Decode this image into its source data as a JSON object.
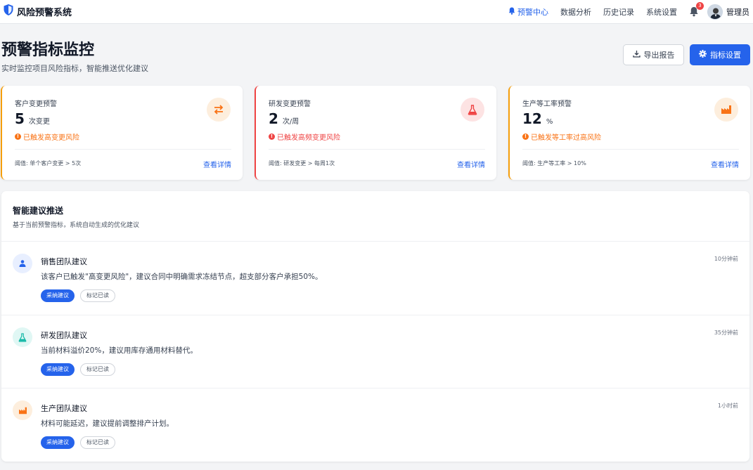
{
  "app": {
    "title": "风险预警系统",
    "logo_icon": "shield-icon",
    "brand_color": "#2563eb"
  },
  "nav": {
    "items": [
      {
        "label": "预警中心",
        "active": true,
        "icon": "bell-icon"
      },
      {
        "label": "数据分析",
        "active": false
      },
      {
        "label": "历史记录",
        "active": false
      },
      {
        "label": "系统设置",
        "active": false
      }
    ],
    "notification_count": "3",
    "user_name": "管理员"
  },
  "header": {
    "title": "预警指标监控",
    "subtitle": "实时监控项目风险指标，智能推送优化建议",
    "export_label": "导出报告",
    "settings_label": "指标设置"
  },
  "cards": [
    {
      "title": "客户变更预警",
      "value": "5",
      "unit": "次变更",
      "alert": "已触发高变更风险",
      "threshold": "阈值: 单个客户变更 > 5次",
      "link": "查看详情",
      "icon": "swap-arrows-icon",
      "accent": "#f59e0b",
      "alert_color": "#f97316"
    },
    {
      "title": "研发变更预警",
      "value": "2",
      "unit": "次/周",
      "alert": "已触发高频变更风险",
      "threshold": "阈值: 研发变更 > 每周1次",
      "link": "查看详情",
      "icon": "flask-icon",
      "accent": "#ef4444",
      "alert_color": "#ef4444"
    },
    {
      "title": "生产等工率预警",
      "value": "12",
      "unit": "%",
      "alert": "已触发等工率过高风险",
      "threshold": "阈值: 生产等工率 > 10%",
      "link": "查看详情",
      "icon": "factory-icon",
      "accent": "#f59e0b",
      "alert_color": "#f97316"
    }
  ],
  "suggestions": {
    "title": "智能建议推送",
    "subtitle": "基于当前预警指标，系统自动生成的优化建议",
    "accept_label": "采纳建议",
    "read_label": "标记已读",
    "items": [
      {
        "title": "销售团队建议",
        "text": "该客户已触发\"高变更风险\"，建议合同中明确需求冻结节点，超支部分客户承担50%。",
        "time": "10分钟前",
        "icon": "team-icon"
      },
      {
        "title": "研发团队建议",
        "text": "当前材料溢价20%，建议用库存通用材料替代。",
        "time": "35分钟前",
        "icon": "flask-icon"
      },
      {
        "title": "生产团队建议",
        "text": "材料可能延迟，建议提前调整排产计划。",
        "time": "1小时前",
        "icon": "factory-icon"
      }
    ]
  }
}
